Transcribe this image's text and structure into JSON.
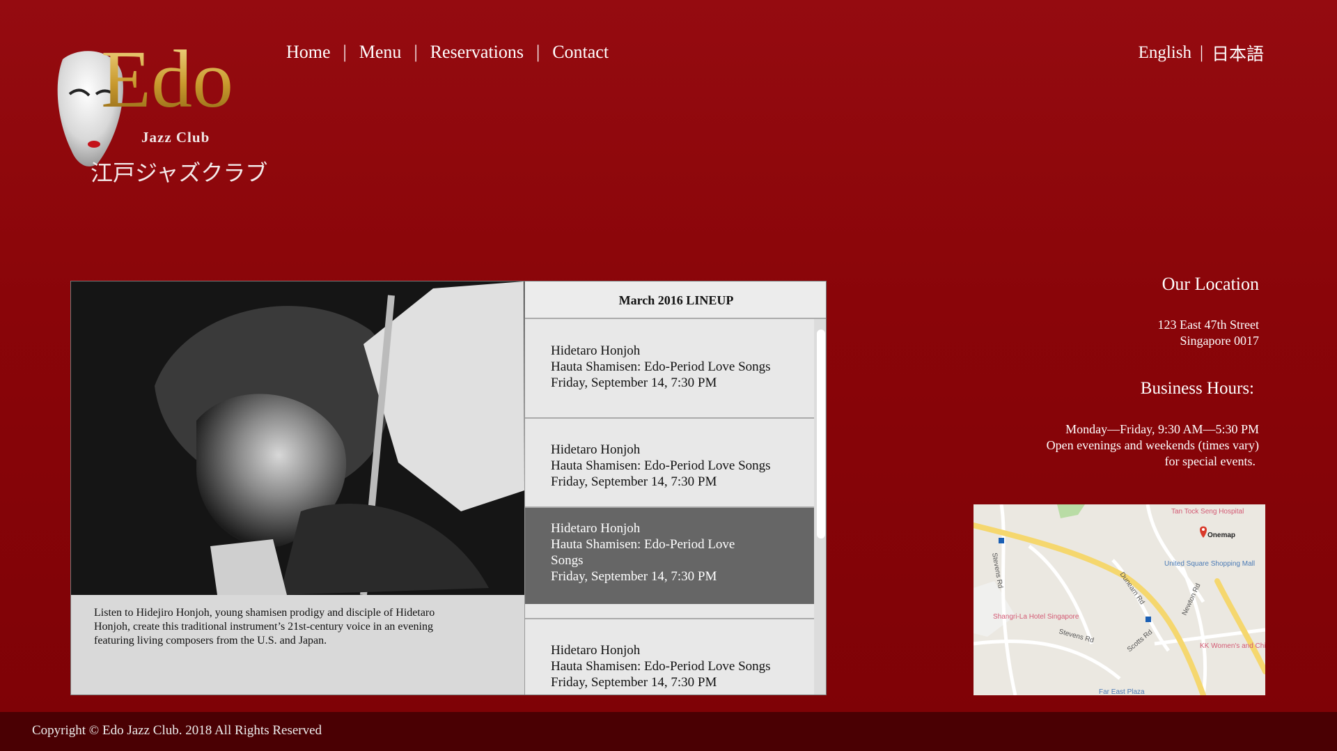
{
  "logo": {
    "brand": "Edo",
    "subtitle": "Jazz Club",
    "japanese": "江戸ジャズクラブ"
  },
  "nav": {
    "items": [
      "Home",
      "Menu",
      "Reservations",
      "Contact"
    ],
    "separator": "|"
  },
  "languages": {
    "english": "English",
    "japanese": "日本語",
    "separator": "|"
  },
  "feature": {
    "caption": "Listen to Hidejiro Honjoh, young shamisen prodigy and disciple of Hidetaro Honjoh, create this traditional instrument’s 21st-century voice in an evening featuring living composers from the U.S. and Japan."
  },
  "lineup": {
    "title": "March 2016 LINEUP",
    "events": [
      {
        "artist": "Hidetaro Honjoh",
        "title": "Hauta Shamisen: Edo-Period Love Songs",
        "date": "Friday, September 14, 7:30 PM"
      },
      {
        "artist": "Hidetaro Honjoh",
        "title": "Hauta Shamisen: Edo-Period Love Songs",
        "date": "Friday, September 14, 7:30 PM"
      },
      {
        "artist": "Hidetaro Honjoh",
        "title": "Hauta Shamisen: Edo-Period Love Songs",
        "date": "Friday, September 14, 7:30 PM",
        "active": true
      },
      {
        "artist": "Hidetaro Honjoh",
        "title": "Hauta Shamisen: Edo-Period Love Songs",
        "date": "Friday, September 14, 7:30 PM"
      }
    ]
  },
  "location": {
    "heading": "Our Location",
    "address_line1": "123 East 47th Street",
    "address_line2": "Singapore 0017",
    "hours_heading": "Business Hours:",
    "hours_line1": "Monday—Friday, 9:30 AM—5:30 PM",
    "hours_line2": "Open evenings and weekends (times vary)",
    "hours_line3": "for special events."
  },
  "map": {
    "labels": {
      "hospital": "Tan Tock Seng Hospital",
      "onemap": "Onemap",
      "mall": "United Square Shopping Mall",
      "hotel": "Shangri-La Hotel Singapore",
      "kk": "KK Women's and Children's Hospital",
      "plaza": "Far East Plaza",
      "dunearn": "Dunearn Rd",
      "stevens": "Stevens Rd",
      "stevens2": "Stevens Rd",
      "newton": "Newton Rd",
      "scotts": "Scotts Rd"
    }
  },
  "footer": {
    "copyright": "Copyright © Edo Jazz Club. 2018 All Rights Reserved"
  },
  "colors": {
    "background": "#8a0509",
    "footer": "#4a0003",
    "gold": "#d4a93a",
    "active_event": "#666666"
  }
}
